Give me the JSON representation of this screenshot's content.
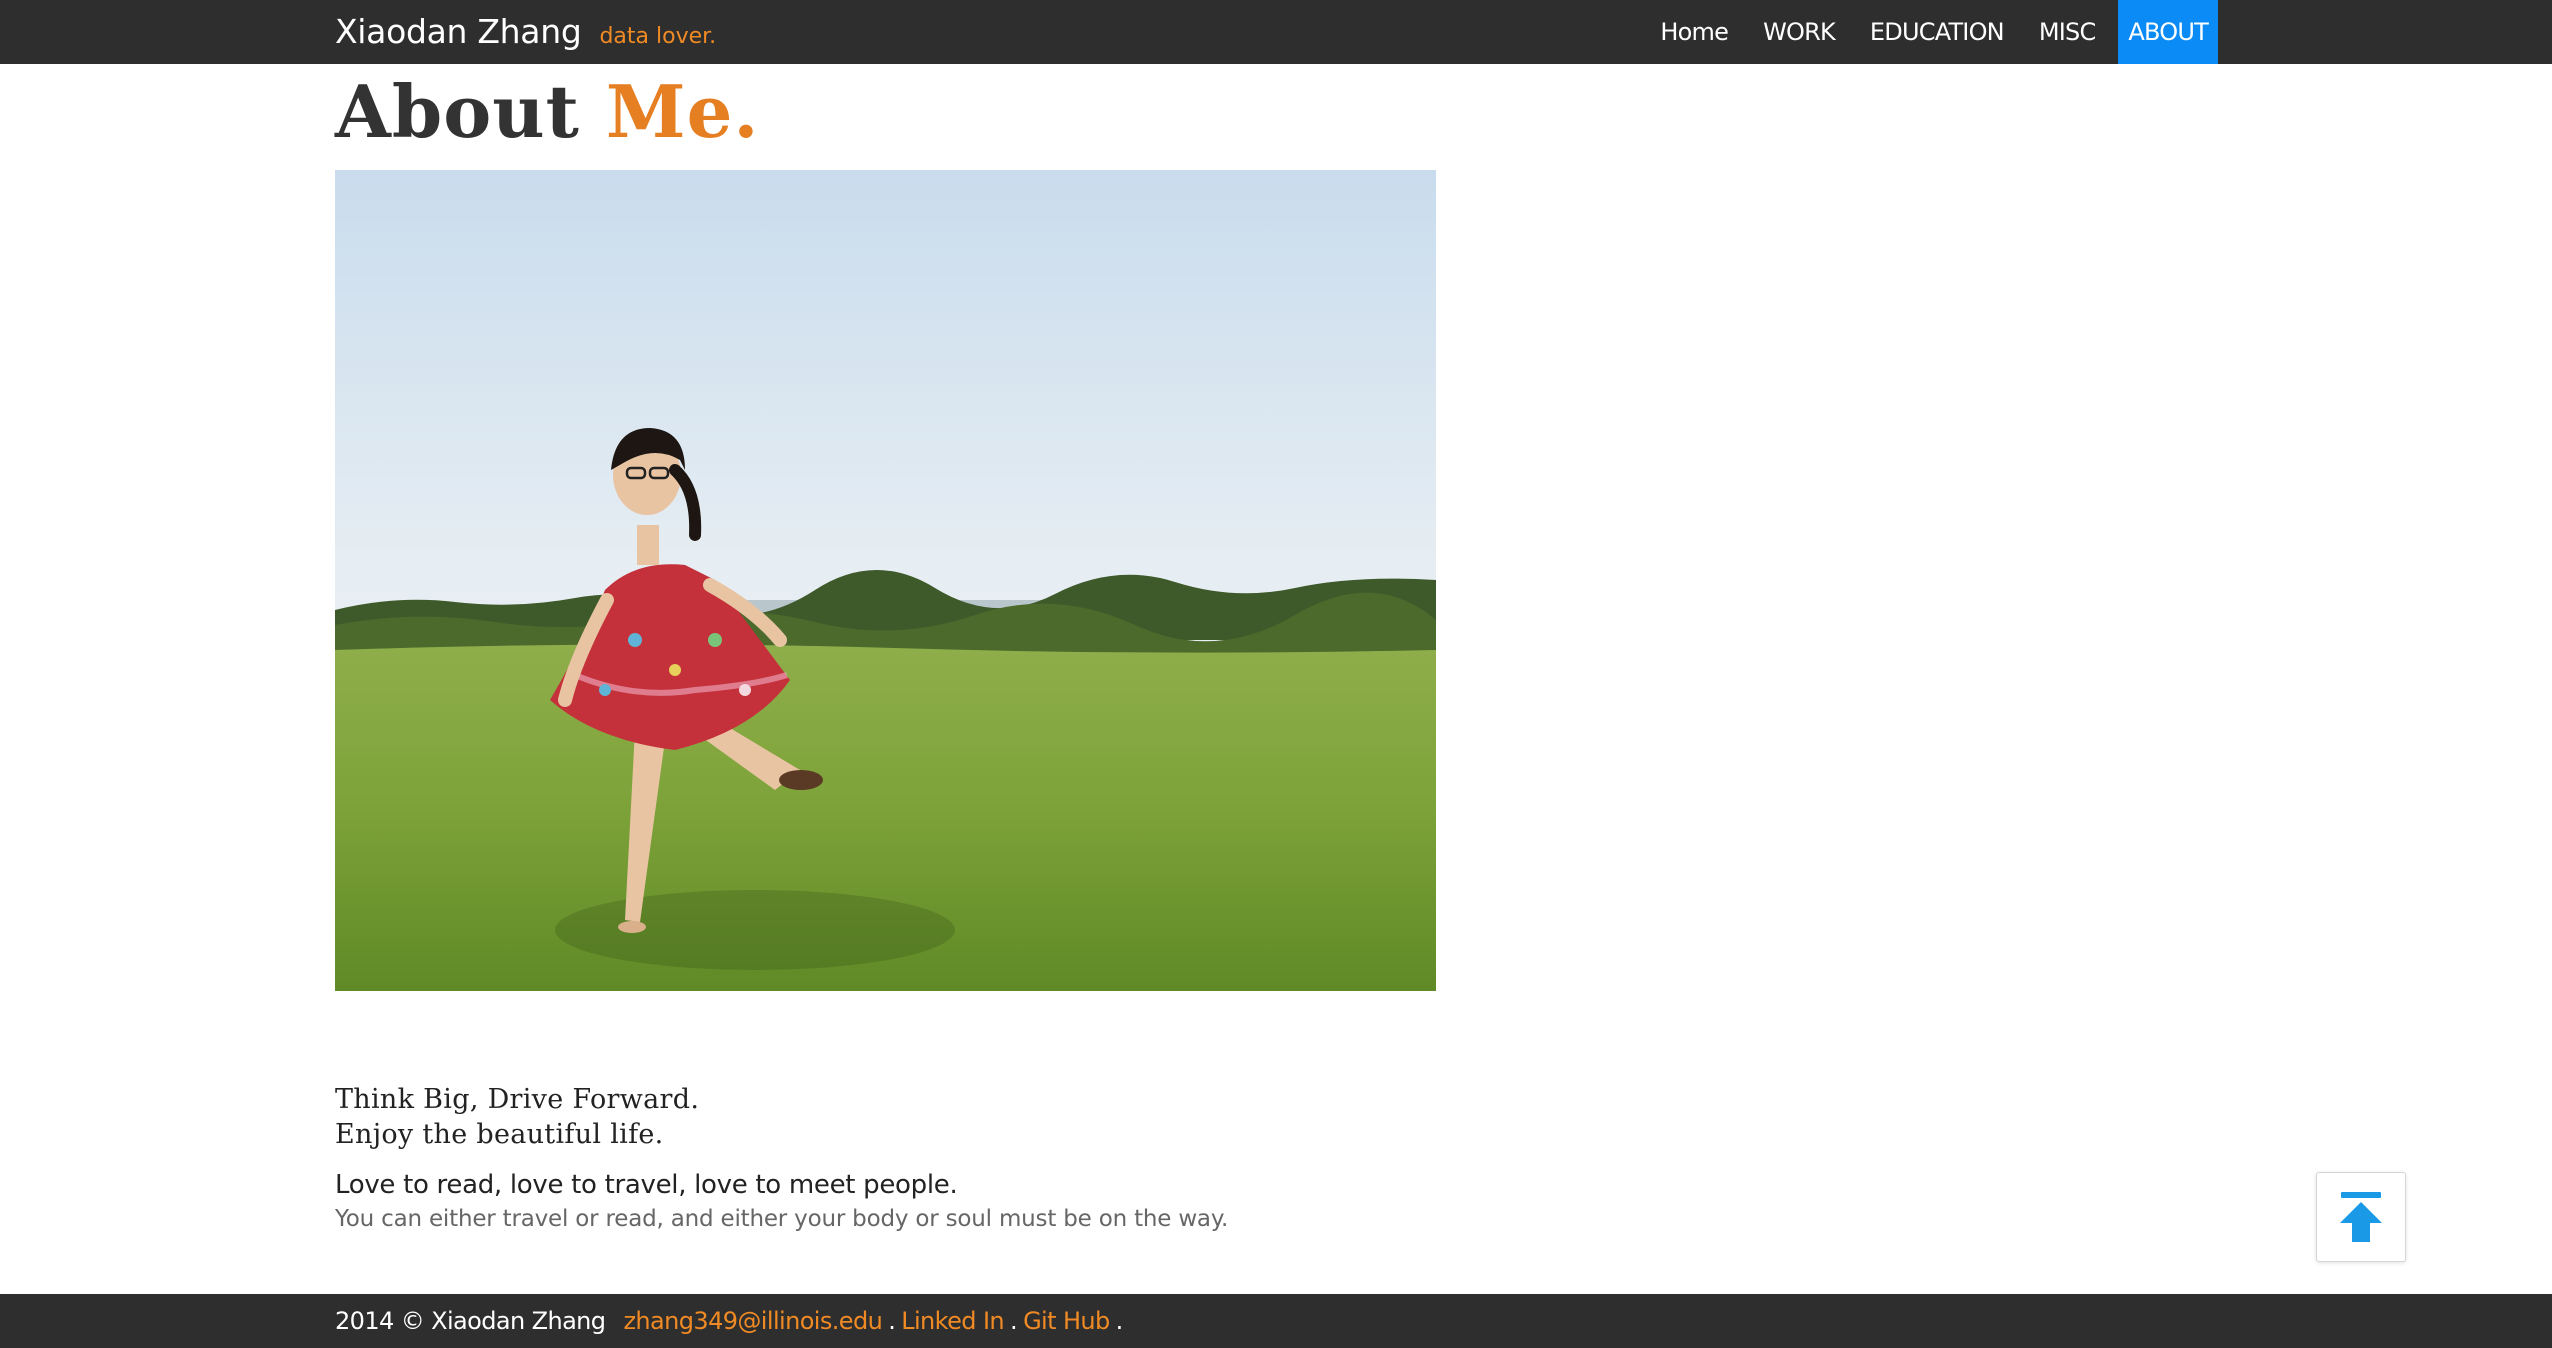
{
  "header": {
    "brand_name": "Xiaodan Zhang",
    "brand_tagline": "data lover."
  },
  "nav": {
    "items": [
      {
        "label": "Home",
        "active": false
      },
      {
        "label": "WORK",
        "active": false
      },
      {
        "label": "EDUCATION",
        "active": false
      },
      {
        "label": "MISC",
        "active": false
      },
      {
        "label": "ABOUT",
        "active": true
      }
    ]
  },
  "main": {
    "title_part1": "About",
    "title_part2": "Me.",
    "quote_line1": "Think Big, Drive Forward.",
    "quote_line2": "Enjoy the beautiful life.",
    "lead": "Love to read, love to travel, love to meet people.",
    "sub": "You can either travel or read, and either your body or soul must be on the way."
  },
  "footer": {
    "copyright": "2014 © Xiaodan Zhang",
    "email": "zhang349@illinois.edu",
    "linkedin": "Linked In",
    "github": "Git Hub",
    "separator": "."
  },
  "colors": {
    "navbar_bg": "#2e2e2e",
    "accent_orange": "#e67e22",
    "nav_active_bg": "#0a8bf5",
    "to_top_arrow": "#1a9ae6"
  },
  "icons": {
    "to_top": "arrow-up-to-line-icon"
  }
}
